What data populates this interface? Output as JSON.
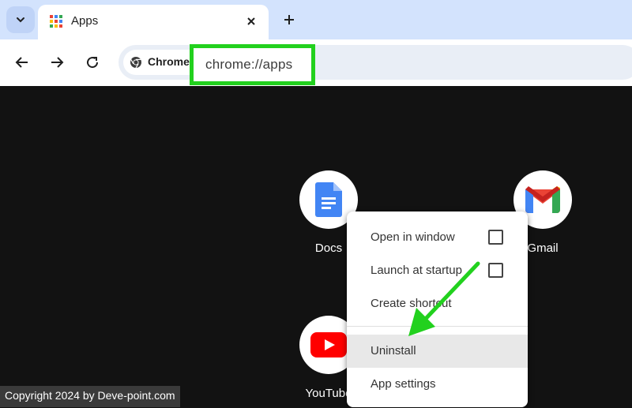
{
  "tab": {
    "title": "Apps"
  },
  "omnibox": {
    "chip_label": "Chrome",
    "url": "chrome://apps"
  },
  "apps": [
    {
      "name": "Docs",
      "icon": "docs-icon"
    },
    {
      "name": "Gmail",
      "icon": "gmail-icon"
    },
    {
      "name": "YouTube",
      "icon": "youtube-icon"
    }
  ],
  "menu": {
    "items": [
      {
        "label": "Open in window",
        "checkbox": true
      },
      {
        "label": "Launch at startup",
        "checkbox": true
      },
      {
        "label": "Create shortcut",
        "checkbox": false
      },
      {
        "label": "Uninstall",
        "checkbox": false
      },
      {
        "label": "App settings",
        "checkbox": false
      }
    ]
  },
  "watermark": "Copyright 2024 by Deve-point.com",
  "colors": {
    "highlight": "#22d11e",
    "tabstrip": "#d3e3fd",
    "page_bg": "#121212"
  }
}
